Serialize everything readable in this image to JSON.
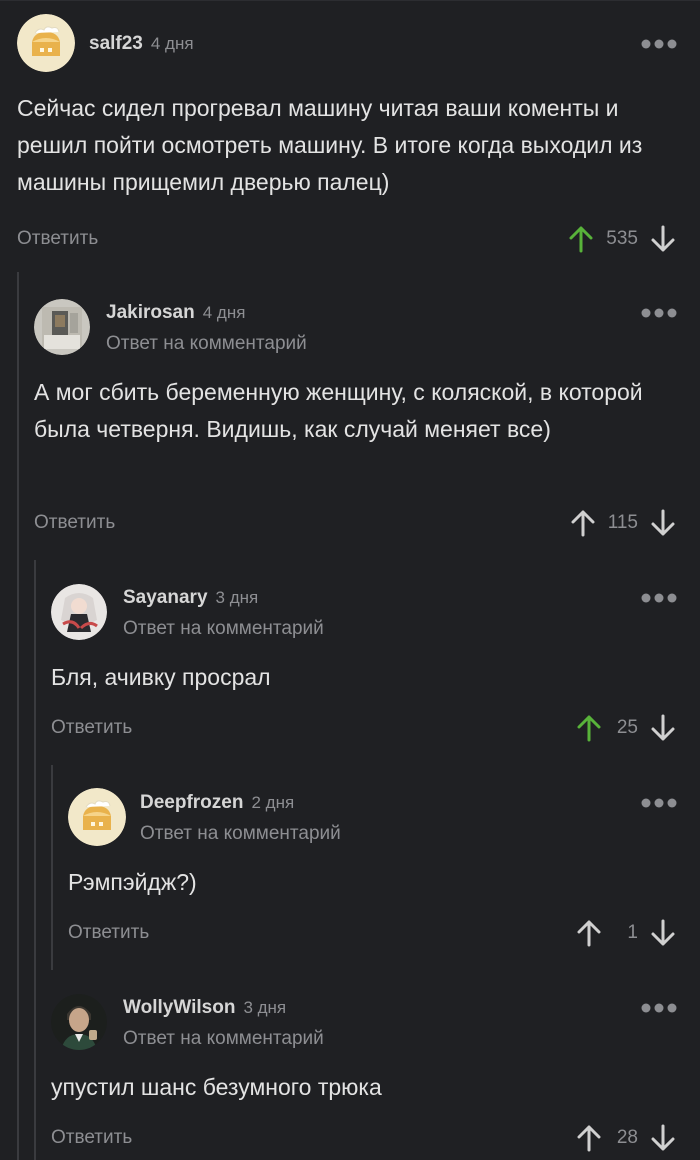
{
  "comments": [
    {
      "username": "salf23",
      "date": "4 дня",
      "subtitle": "",
      "text": "Сейчас сидел прогревал машину читая ваши коменты и решил пойти осмотреть машину. В итоге когда выходил из машины прищемил дверью палец)",
      "reply_label": "Ответить",
      "score": "535",
      "upvoted": true,
      "avatar_icon": "bread-avatar-icon"
    },
    {
      "username": "Jakirosan",
      "date": "4 дня",
      "subtitle": "Ответ на комментарий",
      "text": "А мог сбить беременную женщину, с коляской, в которой была четверня. Видишь, как случай меняет все)",
      "reply_label": "Ответить",
      "score": "115",
      "upvoted": false,
      "avatar_icon": "photo-avatar-icon"
    },
    {
      "username": "Sayanary",
      "date": "3 дня",
      "subtitle": "Ответ на комментарий",
      "text": "Бля, ачивку просрал",
      "reply_label": "Ответить",
      "score": "25",
      "upvoted": true,
      "avatar_icon": "anime-avatar-icon"
    },
    {
      "username": "Deepfrozen",
      "date": "2 дня",
      "subtitle": "Ответ на комментарий",
      "text": "Рэмпэйдж?)",
      "reply_label": "Ответить",
      "score": "1",
      "upvoted": false,
      "avatar_icon": "bread-avatar-icon"
    },
    {
      "username": "WollyWilson",
      "date": "3 дня",
      "subtitle": "Ответ на комментарий",
      "text": "упустил шанс безумного трюка",
      "reply_label": "Ответить",
      "score": "28",
      "upvoted": false,
      "avatar_icon": "portrait-avatar-icon"
    }
  ],
  "colors": {
    "background": "#1f2023",
    "upvote_active": "#58b33a",
    "muted": "#8d8e92"
  }
}
